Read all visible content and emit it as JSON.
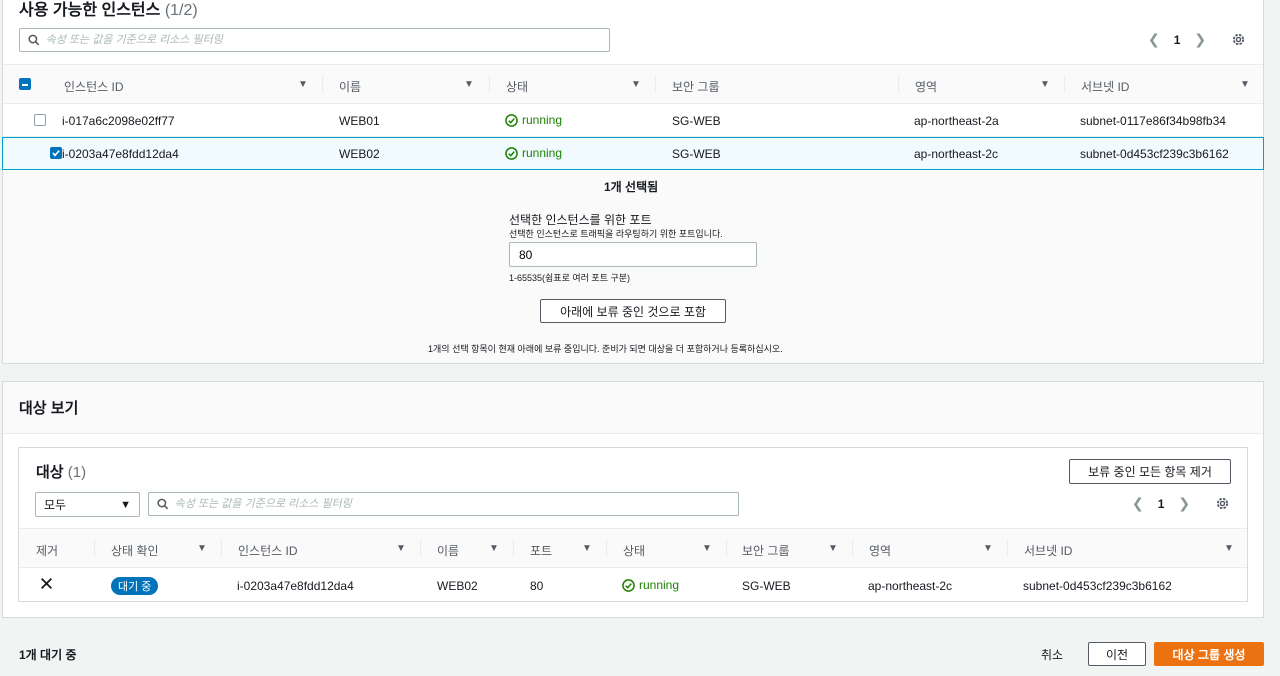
{
  "available": {
    "title": "사용 가능한 인스턴스",
    "count": "(1/2)",
    "search_placeholder": "속성 또는 값을 기준으로 리소스 필터링",
    "page": "1",
    "columns": [
      "인스턴스 ID",
      "이름",
      "상태",
      "보안 그룹",
      "영역",
      "서브넷 ID"
    ],
    "rows": [
      {
        "id": "i-017a6c2098e02ff77",
        "name": "WEB01",
        "state": "running",
        "sg": "SG-WEB",
        "zone": "ap-northeast-2a",
        "subnet": "subnet-0117e86f34b98fb34",
        "selected": false
      },
      {
        "id": "i-0203a47e8fdd12da4",
        "name": "WEB02",
        "state": "running",
        "sg": "SG-WEB",
        "zone": "ap-northeast-2c",
        "subnet": "subnet-0d453cf239c3b6162",
        "selected": true
      }
    ],
    "selected_count": "1개 선택됨",
    "port_label": "선택한 인스턴스를 위한 포트",
    "port_desc": "선택한 인스턴스로 트래픽을 라우팅하기 위한 포트입니다.",
    "port_value": "80",
    "port_hint": "1-65535(쉼표로 여러 포트 구분)",
    "include_button": "아래에 보류 중인 것으로 포함",
    "pending_note": "1개의 선택 항목이 현재 아래에 보류 중입니다. 준비가 되면 대상을 더 포함하거나 등록하십시오."
  },
  "review": {
    "title": "대상 보기",
    "targets_title": "대상",
    "targets_count": "(1)",
    "remove_all_button": "보류 중인 모든 항목 제거",
    "filter_select": "모두",
    "search_placeholder": "속성 또는 값을 기준으로 리소스 필터링",
    "page": "1",
    "columns": [
      "제거",
      "상태 확인",
      "인스턴스 ID",
      "이름",
      "포트",
      "상태",
      "보안 그룹",
      "영역",
      "서브넷 ID"
    ],
    "rows": [
      {
        "health": "대기 중",
        "id": "i-0203a47e8fdd12da4",
        "name": "WEB02",
        "port": "80",
        "state": "running",
        "sg": "SG-WEB",
        "zone": "ap-northeast-2c",
        "subnet": "subnet-0d453cf239c3b6162"
      }
    ]
  },
  "footer": {
    "pending": "1개 대기 중",
    "cancel": "취소",
    "previous": "이전",
    "create": "대상 그룹 생성"
  },
  "colors": {
    "accent": "#0073bb",
    "primary": "#ec7211",
    "running": "#1d8102"
  }
}
